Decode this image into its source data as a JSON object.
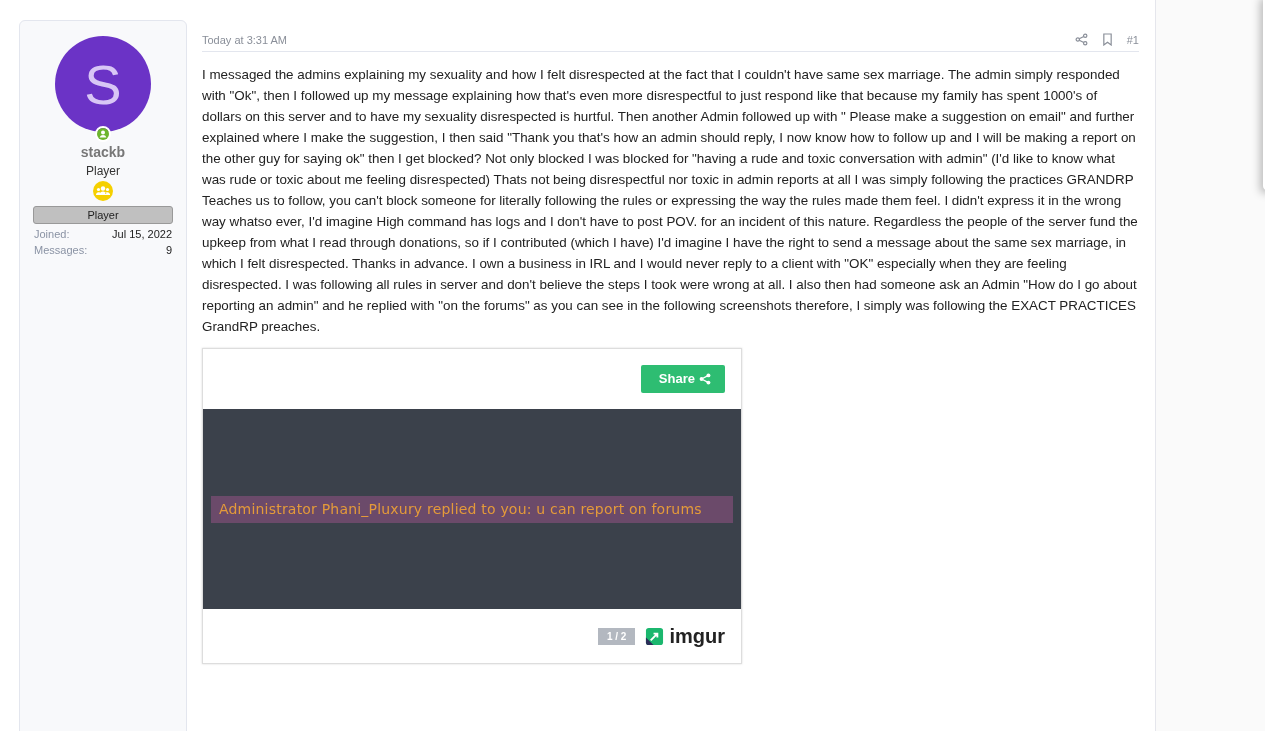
{
  "author": {
    "avatar_letter": "S",
    "online": true,
    "username": "stackb",
    "user_title": "Player",
    "banner": "Player",
    "stats": [
      {
        "label": "Joined:",
        "value": "Jul 15, 2022"
      },
      {
        "label": "Messages:",
        "value": "9"
      }
    ]
  },
  "post": {
    "time": "Today at 3:31 AM",
    "number": "#1",
    "body": "I messaged the admins explaining my sexuality and how I felt disrespected at the fact that I couldn't have same sex marriage. The admin simply responded with \"Ok\", then I followed up my message explaining how that's even more disrespectful to just respond like that because my family has spent 1000's of dollars on this server and to have my sexuality disrespected is hurtful. Then another Admin followed up with \" Please make a suggestion on email\" and further explained where I make the suggestion, I then said \"Thank you that's how an admin should reply, I now know how to follow up and I will be making a report on the other guy for saying ok\" then I get blocked? Not only blocked I was blocked for \"having a rude and toxic conversation with admin\" (I'd like to know what was rude or toxic about me feeling disrespected) Thats not being disrespectful nor toxic in admin reports at all I was simply following the practices GRANDRP Teaches us to follow, you can't block someone for literally following the rules or expressing the way the rules made them feel. I didn't express it in the wrong way whatso ever, I'd imagine High command has logs and I don't have to post POV. for an incident of this nature. Regardless the people of the server fund the upkeep from what I read through donations, so if I contributed (which I have) I'd imagine I have the right to send a message about the same sex marriage, in which I felt disrespected. Thanks in advance. I own a business in IRL and I would never reply to a client with \"OK\" especially when they are feeling disrespected. I was following all rules in server and don't believe the steps I took were wrong at all. I also then had someone ask an Admin \"How do I go about reporting an admin\" and he replied with \"on the forums\" as you can see in the following screenshots therefore, I simply was following the EXACT PRACTICES GrandRP preaches.",
    "embed": {
      "share_label": "Share",
      "screenshot_caption": "Administrator Phani_Pluxury replied to you: u can report on forums",
      "counter": "1 / 2",
      "brand": "imgur"
    }
  }
}
